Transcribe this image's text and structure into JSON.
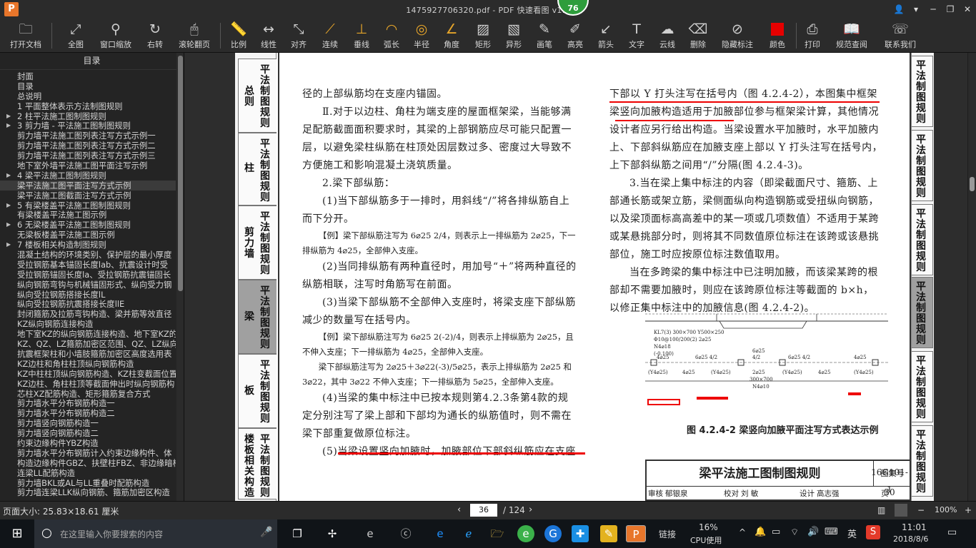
{
  "window": {
    "title": "1475927706320.pdf - PDF 快速看图 v1.9",
    "badge": "76",
    "logo": "P"
  },
  "toolbar": {
    "items": [
      {
        "label": "打开文档",
        "icon": "folder-icon"
      },
      {
        "label": "全图",
        "icon": "fit-page-icon"
      },
      {
        "label": "窗口缩放",
        "icon": "zoom-icon"
      },
      {
        "label": "右转",
        "icon": "rotate-right-icon"
      },
      {
        "label": "滚轮翻页",
        "icon": "mouse-icon"
      },
      {
        "label": "比例",
        "icon": "ruler-icon"
      },
      {
        "label": "线性",
        "icon": "linear-measure-icon"
      },
      {
        "label": "对齐",
        "icon": "aligned-measure-icon"
      },
      {
        "label": "连续",
        "icon": "continuous-measure-icon"
      },
      {
        "label": "垂线",
        "icon": "perpendicular-icon"
      },
      {
        "label": "弧长",
        "icon": "arc-length-icon"
      },
      {
        "label": "半径",
        "icon": "radius-icon"
      },
      {
        "label": "角度",
        "icon": "angle-icon"
      },
      {
        "label": "矩形",
        "icon": "rectangle-area-icon"
      },
      {
        "label": "异形",
        "icon": "polygon-area-icon"
      },
      {
        "label": "画笔",
        "icon": "pen-icon"
      },
      {
        "label": "高亮",
        "icon": "highlighter-icon"
      },
      {
        "label": "箭头",
        "icon": "arrow-icon"
      },
      {
        "label": "文字",
        "icon": "text-icon"
      },
      {
        "label": "云线",
        "icon": "cloud-line-icon"
      },
      {
        "label": "删除",
        "icon": "eraser-icon"
      },
      {
        "label": "隐藏标注",
        "icon": "hide-annotation-icon"
      },
      {
        "label": "颜色",
        "icon": "color-icon"
      },
      {
        "label": "打印",
        "icon": "print-icon"
      },
      {
        "label": "规范查阅",
        "icon": "book-icon"
      },
      {
        "label": "联系我们",
        "icon": "contact-icon"
      }
    ],
    "color_swatch": "#e60000"
  },
  "sidebar": {
    "title": "目录",
    "items": [
      {
        "label": "封面",
        "arrow": ""
      },
      {
        "label": "目录",
        "arrow": ""
      },
      {
        "label": "总说明",
        "arrow": ""
      },
      {
        "label": "1 平面整体表示方法制图规则",
        "arrow": ""
      },
      {
        "label": "2 柱平法施工图制图规则",
        "arrow": "▶"
      },
      {
        "label": "3 剪力墙 - 平法施工图制图规则",
        "arrow": "▶"
      },
      {
        "label": "剪力墙平法施工图列表注写方式示例一",
        "arrow": ""
      },
      {
        "label": "剪力墙平法施工图列表注写方式示例二",
        "arrow": ""
      },
      {
        "label": "剪力墙平法施工图列表注写方式示例三",
        "arrow": ""
      },
      {
        "label": "地下室外墙平法施工图平面注写示例",
        "arrow": ""
      },
      {
        "label": "4 梁平法施工图制图规则",
        "arrow": "▶"
      },
      {
        "label": "梁平法施工图平面注写方式示例",
        "arrow": ""
      },
      {
        "label": "梁平法施工图截面注写方式示例",
        "arrow": ""
      },
      {
        "label": "5 有梁楼盖平法施工图制图规则",
        "arrow": "▶"
      },
      {
        "label": "有梁楼盖平法施工图示例",
        "arrow": ""
      },
      {
        "label": "6 无梁楼盖平法施工图制图规则",
        "arrow": "▶"
      },
      {
        "label": "无梁板楼盖平法施工图示例",
        "arrow": ""
      },
      {
        "label": "7 楼板相关构造制图规则",
        "arrow": "▶"
      },
      {
        "label": "混凝土结构的环境类别、保护层的最小厚度",
        "arrow": ""
      },
      {
        "label": "受拉钢筋基本锚固长度lab、抗震设计时受",
        "arrow": ""
      },
      {
        "label": "受拉钢筋锚固长度la、受拉钢筋抗震锚固长",
        "arrow": ""
      },
      {
        "label": "纵向钢筋弯钩与机械锚固形式、纵向受力钢",
        "arrow": ""
      },
      {
        "label": "纵向受拉钢筋搭接长度lL",
        "arrow": ""
      },
      {
        "label": "纵向受拉钢筋抗震搭接长度llE",
        "arrow": ""
      },
      {
        "label": "封闭箍筋及拉筋弯钩构造、梁并筋等效直径",
        "arrow": ""
      },
      {
        "label": "KZ纵向钢筋连接构造",
        "arrow": ""
      },
      {
        "label": "地下室KZ的纵向钢筋连接构造、地下室KZ的",
        "arrow": ""
      },
      {
        "label": "KZ、QZ、LZ箍筋加密区范围、QZ、LZ纵向钢",
        "arrow": ""
      },
      {
        "label": "抗震框架柱和小墙肢箍筋加密区高度选用表",
        "arrow": ""
      },
      {
        "label": "KZ边柱和角柱柱顶纵向钢筋构造",
        "arrow": ""
      },
      {
        "label": "KZ中柱柱顶纵向钢筋构造、KZ柱变截面位置",
        "arrow": ""
      },
      {
        "label": "KZ边柱、角柱柱顶等截面伸出时纵向钢筋构",
        "arrow": ""
      },
      {
        "label": "芯柱XZ配筋构造、矩形箍筋复合方式",
        "arrow": ""
      },
      {
        "label": "剪力墙水平分布钢筋构造一",
        "arrow": ""
      },
      {
        "label": "剪力墙水平分布钢筋构造二",
        "arrow": ""
      },
      {
        "label": "剪力墙竖向钢筋构造一",
        "arrow": ""
      },
      {
        "label": "剪力墙竖向钢筋构造二",
        "arrow": ""
      },
      {
        "label": "约束边缘构件YBZ构造",
        "arrow": ""
      },
      {
        "label": "剪力墙水平分布钢筋计入约束边缘构件、体",
        "arrow": ""
      },
      {
        "label": "构造边缘构件GBZ、扶壁柱FBZ、非边缘暗柱",
        "arrow": ""
      },
      {
        "label": "连梁LL配筋构造",
        "arrow": ""
      },
      {
        "label": "剪力墙BKL或AL与LL重叠时配筋构造",
        "arrow": ""
      },
      {
        "label": "剪力墙连梁LLK纵向钢筋、箍筋加密区构造",
        "arrow": ""
      }
    ],
    "selected_index": 11
  },
  "page": {
    "left_tabs": [
      {
        "a": "总则",
        "b": "平法制图规则"
      },
      {
        "a": "柱",
        "b": "平法制图规则"
      },
      {
        "a": "剪力墙",
        "b": "平法制图规则"
      },
      {
        "a": "梁",
        "b": "平法制图规则"
      },
      {
        "a": "板",
        "b": "平法制图规则"
      },
      {
        "a": "楼板相关构造",
        "b": "平法制图规则"
      }
    ],
    "right_tabs": [
      "平法制图规则",
      "平法制图规则",
      "平法制图规则",
      "平法制图规则",
      "平法制图规则",
      "平法制图规则"
    ],
    "left_col": [
      "径的上部纵筋均在支座内锚固。",
      "Ⅱ.对于以边柱、角柱为端支座的屋面框架梁，当能够满足配筋截面面积要求时，其梁的上部钢筋应尽可能只配置一层，以避免梁柱纵筋在柱顶处因层数过多、密度过大导致不方便施工和影响混凝土浇筑质量。",
      "2.梁下部纵筋：",
      "(1)当下部纵筋多于一排时，用斜线“/”将各排纵筋自上而下分开。",
      "【例】梁下部纵筋注写为 6⌀25 2/4，则表示上一排纵筋为 2⌀25，下一排纵筋为 4⌀25，全部伸入支座。",
      "(2)当同排纵筋有两种直径时，用加号“＋”将两种直径的纵筋相联，注写时角筋写在前面。",
      "(3)当梁下部纵筋不全部伸入支座时，将梁支座下部纵筋减少的数量写在括号内。",
      "【例】梁下部纵筋注写为 6⌀25 2(-2)/4，则表示上排纵筋为 2⌀25，且不伸入支座；下一排纵筋为 4⌀25，全部伸入支座。",
      "梁下部纵筋注写为 2⌀25＋3⌀22(-3)/5⌀25，表示上排纵筋为 2⌀25 和 3⌀22，其中 3⌀22 不伸入支座；下一排纵筋为 5⌀25，全部伸入支座。",
      "(4)当梁的集中标注中已按本规则第4.2.3条第4款的规定分别注写了梁上部和下部均为通长的纵筋值时，则不需在梁下部重复做原位标注。",
      "(5)当梁设置竖向加腋时，加腋部位下部斜纵筋应在支座"
    ],
    "right_col": [
      "下部以 Y 打头注写在括号内（图 4.2.4-2），本图集中框架梁竖向加腋构造适用于加腋部位参与框架梁计算，其他情况设计者应另行给出构造。当梁设置水平加腋时，水平加腋内上、下部斜纵筋应在加腋支座上部以 Y 打头注写在括号内，上下部斜纵筋之间用“/”分隔(图 4.2.4-3)。",
      "3.当在梁上集中标注的内容（即梁截面尺寸、箍筋、上部通长筋或架立筋，梁侧面纵向构造钢筋或受扭纵向钢筋，以及梁顶面标高高差中的某一项或几项数值）不适用于某跨或某悬挑部分时，则将其不同数值原位标注在该跨或该悬挑部位，施工时应按原位标注数值取用。",
      "当在多跨梁的集中标注中已注明加腋，而该梁某跨的根部却不需要加腋时，则应在该跨原位标注等截面的 b×h，以修正集中标注中的加腋信息(图 4.2.4-2)。"
    ],
    "figure": {
      "caption": "图 4.2.4-2  梁竖向加腋平面注写方式表达示例",
      "labels": [
        "KL7(3)  300×700  Y500×250",
        "Φ10@100/200(2)  2⌀25",
        "N4⌀18",
        "(-0.100)",
        "4⌀25",
        "6⌀25 4/2",
        "6⌀25",
        "4/2",
        "6⌀25 4/2",
        "4⌀25",
        "(Y4⌀25)",
        "4⌀25",
        "(Y4⌀25)",
        "2⌀25",
        "(Y4⌀25)",
        "4⌀25",
        "(Y4⌀25)",
        "300×700",
        "N4⌀10"
      ]
    },
    "title_block": {
      "title": "梁平法施工图制图规则",
      "set_label": "图集号",
      "set_no": "16G101-1",
      "page_label": "页",
      "page_no": "30",
      "review": "审核",
      "reviewer": "郁银泉",
      "check": "校对",
      "checker": "刘 敏",
      "design": "设计",
      "designer": "高志强"
    }
  },
  "status": {
    "page_size": "页面大小: 25.83×18.61 厘米",
    "current_page": "36",
    "total_pages": "/ 124",
    "zoom": "100%"
  },
  "taskbar": {
    "search_placeholder": "在这里输入你要搜索的内容",
    "link_label": "链接",
    "cpu_value": "16%",
    "cpu_label": "CPU使用",
    "ime": "英",
    "time": "11:01",
    "date": "2018/8/6"
  }
}
